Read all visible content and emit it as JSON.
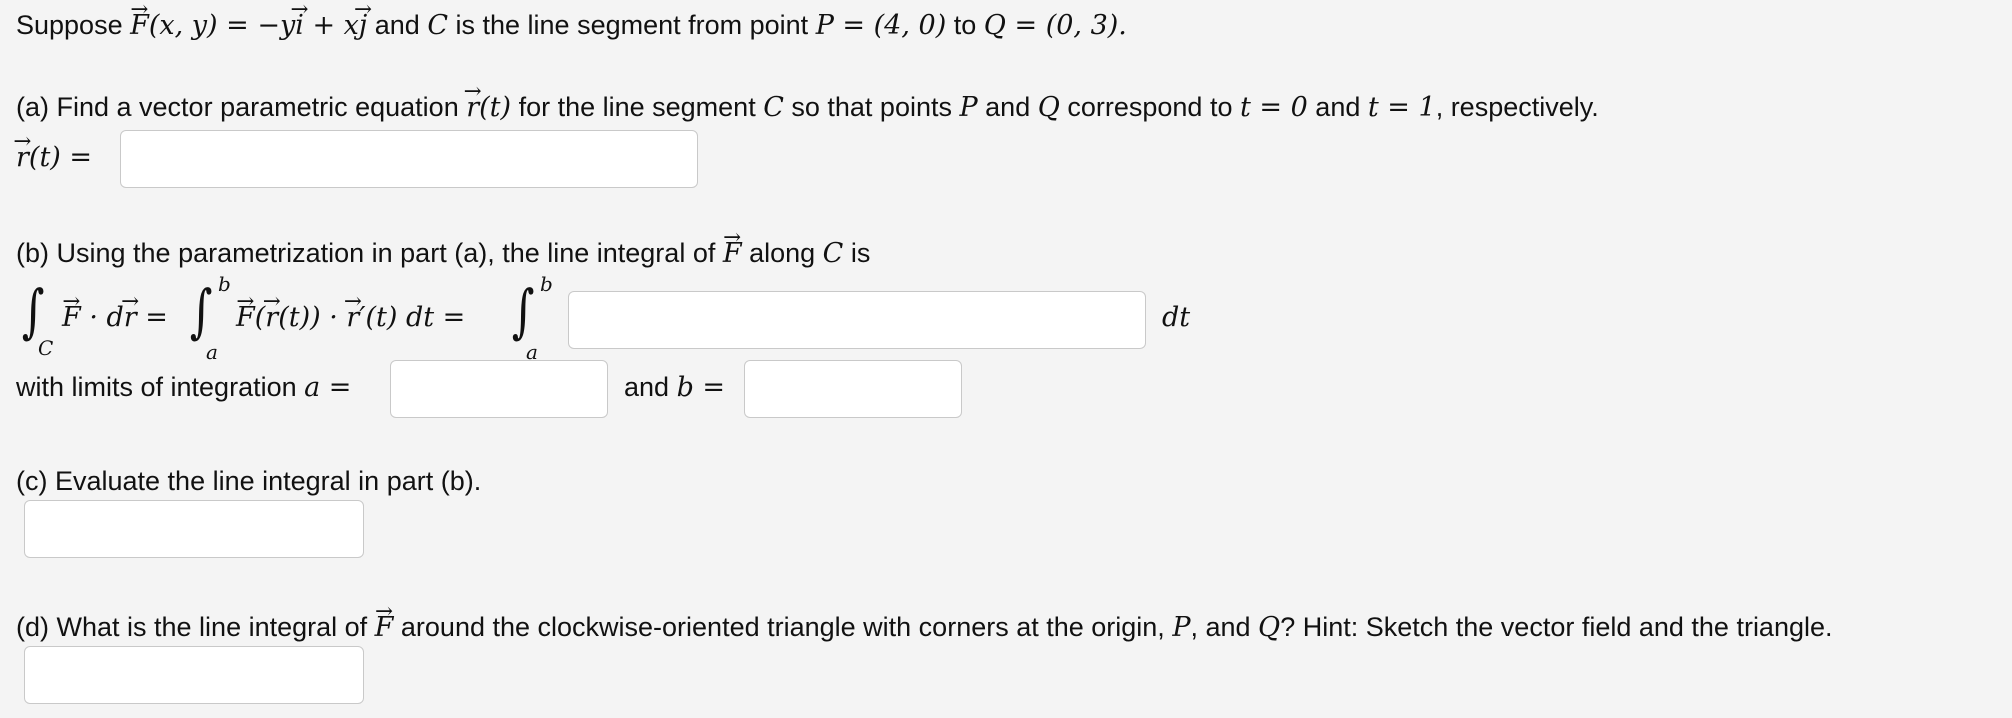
{
  "intro": {
    "suppose": "Suppose",
    "F": "F",
    "field_args": "(x, y) = −y",
    "i": "i",
    "plus_x": " + x",
    "j": "j",
    "and_C": " and ",
    "C": "C",
    "segment_text": " is the line segment from point ",
    "P_def": "P = (4, 0)",
    "to": " to ",
    "Q_def": "Q = (0, 3)."
  },
  "part_a": {
    "prefix": "(a) Find a vector parametric equation ",
    "r": "r",
    "rt": "(t)",
    "mid1": " for the line segment ",
    "C": "C",
    "mid2": " so that points ",
    "P": "P",
    "and": " and ",
    "Q": "Q",
    "mid3": " correspond to ",
    "t0": "t = 0",
    "and2": " and ",
    "t1": "t = 1",
    "suffix": ", respectively.",
    "label_r": "r",
    "label_rest": "(t) =",
    "answer": ""
  },
  "part_b": {
    "prefix": "(b) Using the parametrization in part (a), the line integral of ",
    "F": "F",
    "mid": " along ",
    "C": "C",
    "suffix": " is",
    "int1_sub": "C",
    "F1": "F",
    "dot_d": " · d",
    "r1": "r",
    "eq1": " =",
    "int2_lower": "a",
    "int2_upper": "b",
    "F2": "F",
    "open": "(",
    "r2": "r",
    "close": "(t)) · ",
    "r3": "r",
    "prime_dt": "′(t) dt =",
    "int3_lower": "a",
    "int3_upper": "b",
    "integrand_answer": "",
    "dt": "dt",
    "limits_text": "with limits of integration ",
    "a_eq": "a =",
    "and_text": "and ",
    "b_eq": "b =",
    "a_answer": "",
    "b_answer": ""
  },
  "part_c": {
    "text": "(c) Evaluate the line integral in part (b).",
    "answer": ""
  },
  "part_d": {
    "prefix": "(d) What is the line integral of ",
    "F": "F",
    "mid": " around the clockwise-oriented triangle with corners at the origin, ",
    "P": "P",
    "comma_and": ", and ",
    "Q": "Q",
    "suffix": "? Hint: Sketch the vector field and the triangle.",
    "answer": ""
  }
}
